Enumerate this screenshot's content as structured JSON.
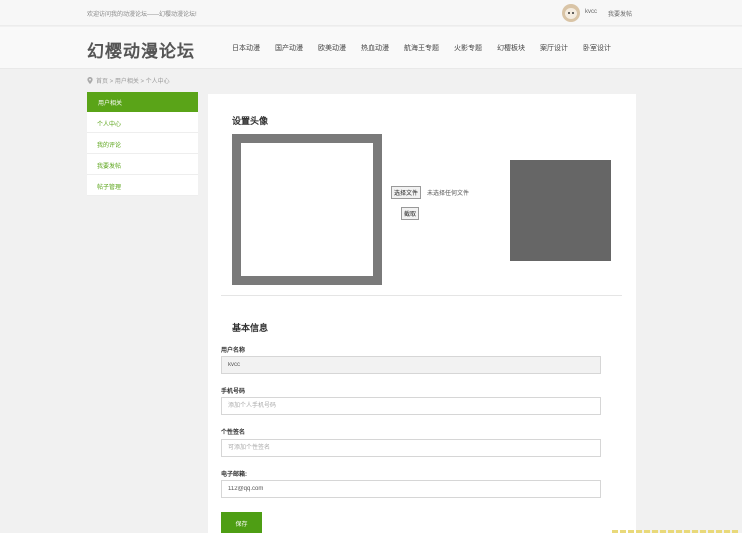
{
  "topbar": {
    "welcome": "欢迎访问我的动漫论坛——幻樱动漫论坛!",
    "username": "kvcc",
    "post_link": "我要发帖"
  },
  "header": {
    "logo": "幻樱动漫论坛",
    "nav": [
      "日本动漫",
      "国产动漫",
      "欧美动漫",
      "热血动漫",
      "航海王专题",
      "火影专题",
      "幻樱板块",
      "案厅设计",
      "卧室设计"
    ]
  },
  "breadcrumb": "首页 > 用户相关 > 个人中心",
  "sidebar": {
    "header": "用户相关",
    "items": [
      "个人中心",
      "我的评论",
      "我要发帖",
      "帖子管理"
    ]
  },
  "avatar_section": {
    "title": "设置头像",
    "choose_file": "选择文件",
    "file_status": "未选择任何文件",
    "crop": "截取"
  },
  "basic_info": {
    "title": "基本信息",
    "username_label": "用户名称",
    "username_value": "kvcc",
    "phone_label": "手机号码",
    "phone_placeholder": "添加个人手机号码",
    "sig_label": "个性签名",
    "sig_placeholder": "可添加个性签名",
    "email_label": "电子邮箱:",
    "email_value": "112@qq.com",
    "save": "保存"
  },
  "colors": {
    "accent": "#5aa418",
    "sidebar_header": "#5aa418",
    "crop_frame": "#7a7a7a",
    "preview": "#666666"
  }
}
